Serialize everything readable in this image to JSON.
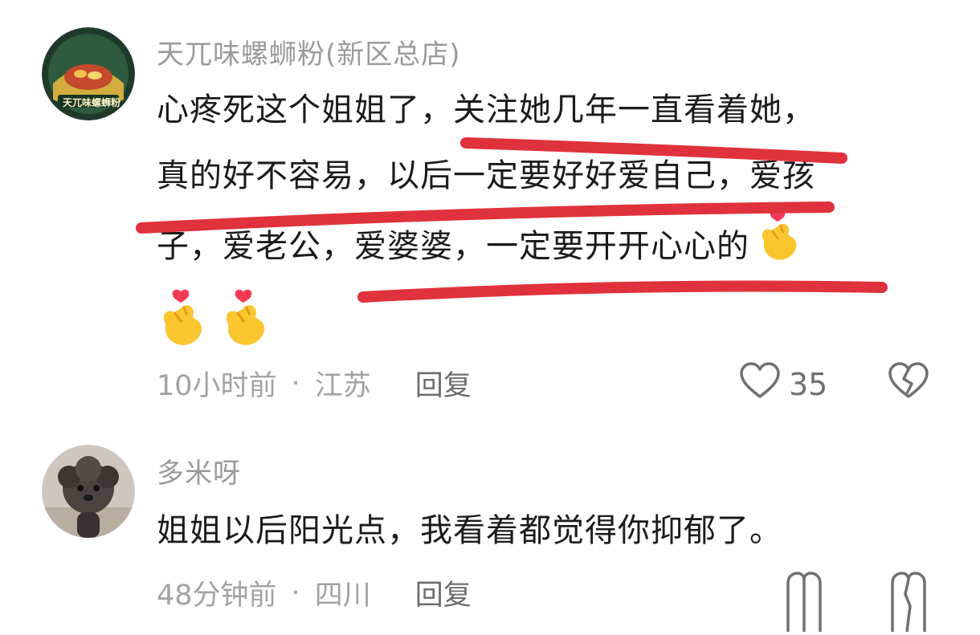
{
  "comments": [
    {
      "username": "天兀味螺蛳粉(新区总店)",
      "avatar_text": "天兀味螺蛳粉",
      "lines": [
        "心疼死这个姐姐了，关注她几年一直看着她，",
        "真的好不容易，以后一定要好好爱自己，爱孩",
        "子，爱老公，爱婆婆，一定要开开心心的"
      ],
      "emoji": "finger-heart-icon",
      "time": "10小时前",
      "location": "江苏",
      "separator": "·",
      "reply_label": "回复",
      "like_count": "35"
    },
    {
      "username": "多米呀",
      "text": "姐姐以后阳光点，我看着都觉得你抑郁了。",
      "time": "48分钟前",
      "location": "四川",
      "separator": "·",
      "reply_label": "回复"
    }
  ],
  "colors": {
    "username": "#9a9a9a",
    "body": "#1b1b1b",
    "meta": "#a3a3a3",
    "underline": "#e0323c"
  }
}
